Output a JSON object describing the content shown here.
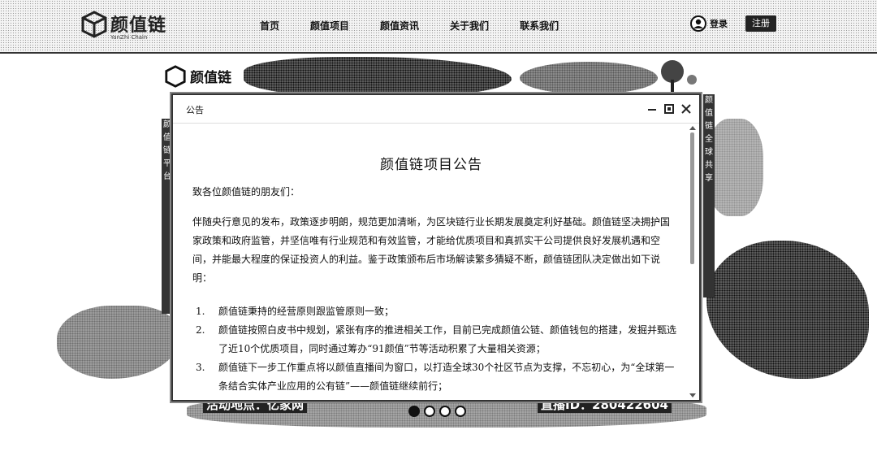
{
  "header": {
    "logo_text": "颜值链",
    "logo_sub": "YanZhi Chain",
    "nav": [
      "首页",
      "颜值项目",
      "颜值资讯",
      "关于我们",
      "联系我们"
    ],
    "login": "登录",
    "register": "注册"
  },
  "banner": {
    "logo_text": "颜值链",
    "left_column": "颜值链平台",
    "right_column": "颜值链全球共享",
    "bottom_left": "活动地点：亿家网",
    "bottom_right": "直播ID：280422604"
  },
  "modal": {
    "title": "公告",
    "doc_title": "颜值链项目公告",
    "greeting": "致各位颜值链的朋友们：",
    "paragraph": "伴随央行意见的发布，政策逐步明朗，规范更加清晰，为区块链行业长期发展奠定利好基础。颜值链坚决拥护国家政策和政府监管，并坚信唯有行业规范和有效监管，才能给优质项目和真抓实干公司提供良好发展机遇和空间，并能最大程度的保证投资人的利益。鉴于政策颁布后市场解读繁多猜疑不断，颜值链团队决定做出如下说明：",
    "items": [
      {
        "num": "1.",
        "text": "颜值链秉持的经营原则跟监管原则一致；"
      },
      {
        "num": "2.",
        "text": "颜值链按照白皮书中规划，紧张有序的推进相关工作，目前已完成颜值公链、颜值钱包的搭建，发掘并甄选了近10个优质项目，同时通过筹办“91颜值”节等活动积累了大量相关资源；"
      },
      {
        "num": "3.",
        "text": "颜值链下一步工作重点将以颜值直播间为窗口，以打造全球30个社区节点为支撑，不忘初心，为“全球第一条结合实体产业应用的公有链”——颜值链继续前行；"
      }
    ]
  },
  "colors": {
    "header_bg": "#f4f4f4",
    "dark": "#222222",
    "modal_bg": "#ffffff"
  },
  "icons": [
    "cube-logo-icon",
    "user-icon",
    "minimize-icon",
    "maximize-icon",
    "close-icon"
  ]
}
